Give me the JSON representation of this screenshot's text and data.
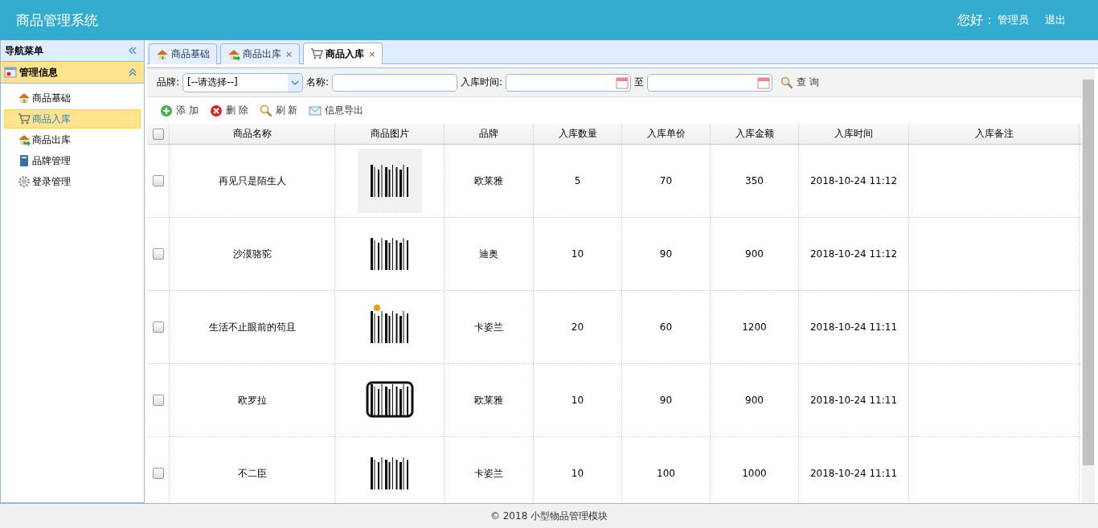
{
  "header": {
    "title": "商品管理系统",
    "greeting": "您好：",
    "user": "管理员",
    "logout": "退出"
  },
  "sidebar": {
    "title": "导航菜单",
    "group": {
      "label": "管理信息",
      "expanded": true
    },
    "items": [
      {
        "label": "商品基础",
        "kind": "house",
        "selected": false
      },
      {
        "label": "商品入库",
        "kind": "cart",
        "selected": true
      },
      {
        "label": "商品出库",
        "kind": "exit",
        "selected": false
      },
      {
        "label": "品牌管理",
        "kind": "book",
        "selected": false
      },
      {
        "label": "登录管理",
        "kind": "gear",
        "selected": false
      }
    ]
  },
  "tabs": [
    {
      "label": "商品基础",
      "kind": "house",
      "closable": false,
      "selected": false
    },
    {
      "label": "商品出库",
      "kind": "exit",
      "closable": true,
      "selected": false
    },
    {
      "label": "商品入库",
      "kind": "cart",
      "closable": true,
      "selected": true
    }
  ],
  "close_mark": "×",
  "filters": {
    "brand_label": "品牌:",
    "brand_value": "[--请选择--]",
    "name_label": "名称:",
    "time_label": "入库时间:",
    "to_label": "至",
    "search": "查 询"
  },
  "actions": [
    {
      "label": "添 加",
      "kind": "add"
    },
    {
      "label": "删 除",
      "kind": "delete"
    },
    {
      "label": "刷 新",
      "kind": "refresh"
    },
    {
      "label": "信息导出",
      "kind": "export"
    }
  ],
  "table": {
    "header_checked": false,
    "columns": [
      "商品名称",
      "商品图片",
      "品牌",
      "入库数量",
      "入库单价",
      "入库金额",
      "入库时间",
      "入库备注"
    ],
    "rows": [
      {
        "checked": false,
        "name": "再见只是陌生人",
        "brand": "欧莱雅",
        "qty": "5",
        "price": "70",
        "amount": "350",
        "time": "2018-10-24 11:12"
      },
      {
        "checked": false,
        "name": "沙漠骆驼",
        "brand": "迪奥",
        "qty": "10",
        "price": "90",
        "amount": "900",
        "time": "2018-10-24 11:12"
      },
      {
        "checked": false,
        "name": "生活不止眼前的苟且",
        "brand": "卡姿兰",
        "qty": "20",
        "price": "60",
        "amount": "1200",
        "time": "2018-10-24 11:11"
      },
      {
        "checked": false,
        "name": "欧罗拉",
        "brand": "欧莱雅",
        "qty": "10",
        "price": "90",
        "amount": "900",
        "time": "2018-10-24 11:11"
      },
      {
        "checked": false,
        "name": "不二臣",
        "brand": "卡姿兰",
        "qty": "10",
        "price": "100",
        "amount": "1000",
        "time": "2018-10-24 11:11"
      }
    ]
  },
  "footer": "© 2018 小型物品管理模块"
}
